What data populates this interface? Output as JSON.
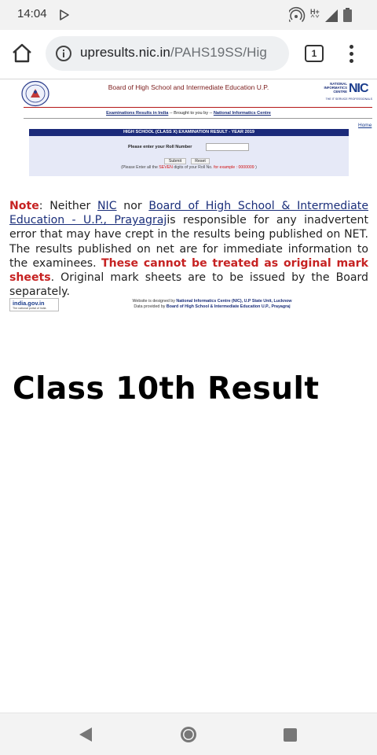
{
  "status_bar": {
    "time": "14:04",
    "network_type": "H+",
    "icons": [
      "play-store-icon",
      "hotspot-icon",
      "signal-icon",
      "battery-icon"
    ]
  },
  "browser": {
    "url_host": "upresults.nic.in",
    "url_path": "/PAHS19SS/Hig",
    "tab_count": "1",
    "icons": [
      "home-icon",
      "info-icon",
      "tabs-icon",
      "more-vert-icon"
    ]
  },
  "site": {
    "board_title": "Board of High School and Intermediate Education U.P.",
    "nic_logo": {
      "line1": "NATIONAL",
      "line2": "INFORMATICS",
      "line3": "CENTRE",
      "mark": "NIC",
      "tagline": "THE IT SERVICE PROFESSIONALS"
    },
    "sub_links": {
      "link1": "Examinations Results in India",
      "sep1": " -- Brought to you by -- ",
      "link2": "National Informatics Centre"
    },
    "home_link": "Home",
    "form": {
      "bar_title": "HIGH SCHOOL (CLASS X)  EXAMINATION RESULT - YEAR 2019",
      "roll_label": "Please enter your Roll Number",
      "roll_value": "",
      "submit_label": "Submit",
      "reset_label": "Reset",
      "hint_pre": "(Please Enter all the ",
      "hint_seven": "SEVEN",
      "hint_mid": " digits of your Roll No. ",
      "hint_example": "for example : 0000009",
      "hint_post": " )"
    },
    "note": {
      "label": "Note",
      "t1": ": Neither ",
      "link_nic": "NIC",
      "t2": " nor ",
      "link_board": "Board of High School & Intermediate Education - U.P., Prayagraj",
      "t3": "is responsible for any inadvertent error that may have crept in the results being published on NET. The results published on net are for immediate information to the examinees. ",
      "warning": "These cannot be treated as original mark sheets",
      "t4": ". Original mark sheets are to be issued by the Board separately."
    },
    "footer": {
      "india_logo_main": "india.gov.in",
      "india_logo_sub": "The national portal of India",
      "credit1_pre": "Website is designed by ",
      "credit1_bold": "National Informatics Centre (NIC), U.P State Unit, Lucknow",
      "credit2_pre": "Data provided by ",
      "credit2_bold": "Board of High School & Intermediate Education U.P., Prayagraj"
    }
  },
  "caption": "Class 10th Result",
  "nav_bar": {
    "icons": [
      "back-icon",
      "home-circle-icon",
      "recents-icon"
    ]
  }
}
